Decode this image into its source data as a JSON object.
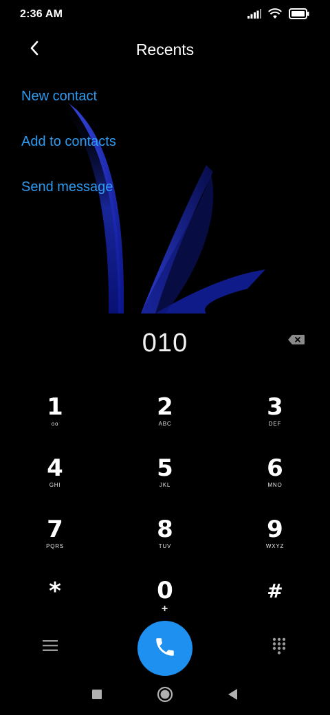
{
  "status_bar": {
    "time": "2:36 AM"
  },
  "header": {
    "title": "Recents",
    "back_icon": "chevron-left-icon"
  },
  "actions": [
    {
      "label": "New contact"
    },
    {
      "label": "Add to contacts"
    },
    {
      "label": "Send message"
    }
  ],
  "dialer": {
    "number": "010"
  },
  "keypad": [
    {
      "digit": "1",
      "letters": "oo"
    },
    {
      "digit": "2",
      "letters": "ABC"
    },
    {
      "digit": "3",
      "letters": "DEF"
    },
    {
      "digit": "4",
      "letters": "GHI"
    },
    {
      "digit": "5",
      "letters": "JKL"
    },
    {
      "digit": "6",
      "letters": "MNO"
    },
    {
      "digit": "7",
      "letters": "PQRS"
    },
    {
      "digit": "8",
      "letters": "TUV"
    },
    {
      "digit": "9",
      "letters": "WXYZ"
    },
    {
      "digit": "*",
      "letters": ""
    },
    {
      "digit": "0",
      "letters": "+"
    },
    {
      "digit": "#",
      "letters": ""
    }
  ],
  "colors": {
    "accent": "#2f9bf0",
    "call_button": "#1e90f0",
    "background": "#000000"
  },
  "icons": {
    "menu": "hamburger-menu-icon",
    "call": "phone-icon",
    "dialpad": "dialpad-icon",
    "backspace": "backspace-icon",
    "nav_recents": "square-icon",
    "nav_home": "circle-icon",
    "nav_back": "triangle-back-icon"
  }
}
